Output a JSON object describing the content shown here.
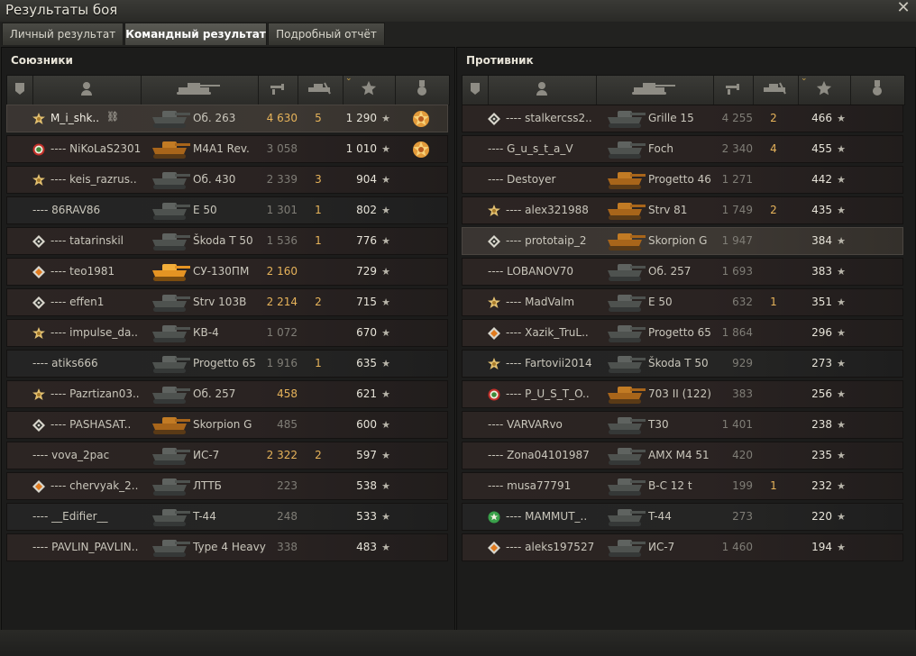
{
  "window": {
    "title": "Результаты боя"
  },
  "tabs": [
    {
      "label": "Личный результат",
      "active": false
    },
    {
      "label": "Командный результат",
      "active": true
    },
    {
      "label": "Подробный отчёт",
      "active": false
    }
  ],
  "columns": [
    "squad-icon",
    "player-icon",
    "tank-icon",
    "damage-icon",
    "kills-icon",
    "xp-star-icon",
    "medal-icon"
  ],
  "sort_column": "xp",
  "colors": {
    "accent": "#e6b35a",
    "dim_text": "#7f7d76",
    "text": "#c9c6bb",
    "highlight_row": "#3d3833"
  },
  "allies": {
    "title": "Союзники",
    "rows": [
      {
        "player": "M_i_shk..",
        "rank": "gold",
        "vehicle": "Об. 263",
        "tank_color": "gray",
        "damage": "4 630",
        "damage_hi": true,
        "kills": "5",
        "xp": "1 290",
        "star": "★",
        "medal": true,
        "squad": true,
        "highlight": true
      },
      {
        "player": "---- NiKoLaS2301",
        "rank": "red-green",
        "vehicle": "M4A1 Rev.",
        "tank_color": "orange",
        "damage": "3 058",
        "damage_hi": false,
        "kills": "",
        "xp": "1 010",
        "star": "★",
        "medal": true,
        "squad": false,
        "highlight": false
      },
      {
        "player": "---- keis_razrus..",
        "rank": "gold",
        "vehicle": "Об. 430",
        "tank_color": "gray",
        "damage": "2 339",
        "damage_hi": false,
        "kills": "3",
        "xp": "904",
        "star": "★",
        "medal": false,
        "squad": false,
        "highlight": false
      },
      {
        "player": "---- 86RAV86",
        "rank": "",
        "vehicle": "E 50",
        "tank_color": "gray",
        "damage": "1 301",
        "damage_hi": false,
        "kills": "1",
        "xp": "802",
        "star": "★",
        "medal": false,
        "squad": false,
        "highlight": false
      },
      {
        "player": "---- tatarinskil",
        "rank": "white",
        "vehicle": "Škoda T 50",
        "tank_color": "gray",
        "damage": "1 536",
        "damage_hi": false,
        "kills": "1",
        "xp": "776",
        "star": "★",
        "medal": false,
        "squad": false,
        "highlight": false
      },
      {
        "player": "---- teo1981",
        "rank": "orange",
        "vehicle": "СУ-130ПМ",
        "tank_color": "bright-orange",
        "damage": "2 160",
        "damage_hi": true,
        "kills": "",
        "xp": "729",
        "star": "★",
        "medal": false,
        "squad": false,
        "highlight": false
      },
      {
        "player": "---- effen1",
        "rank": "white",
        "vehicle": "Strv 103B",
        "tank_color": "gray",
        "damage": "2 214",
        "damage_hi": true,
        "kills": "2",
        "xp": "715",
        "star": "★",
        "medal": false,
        "squad": false,
        "highlight": false
      },
      {
        "player": "---- impulse_da..",
        "rank": "gold",
        "vehicle": "КВ-4",
        "tank_color": "gray",
        "damage": "1 072",
        "damage_hi": false,
        "kills": "",
        "xp": "670",
        "star": "★",
        "medal": false,
        "squad": false,
        "highlight": false
      },
      {
        "player": "---- atiks666",
        "rank": "",
        "vehicle": "Progetto 65",
        "tank_color": "gray",
        "damage": "1 916",
        "damage_hi": false,
        "kills": "1",
        "xp": "635",
        "star": "★",
        "medal": false,
        "squad": false,
        "highlight": false
      },
      {
        "player": "---- Pazrtizan03..",
        "rank": "gold",
        "vehicle": "Об. 257",
        "tank_color": "gray",
        "damage": "458",
        "damage_hi": true,
        "kills": "",
        "xp": "621",
        "star": "★",
        "medal": false,
        "squad": false,
        "highlight": false
      },
      {
        "player": "---- PASHASAT..",
        "rank": "white",
        "vehicle": "Skorpion G",
        "tank_color": "orange",
        "damage": "485",
        "damage_hi": false,
        "kills": "",
        "xp": "600",
        "star": "★",
        "medal": false,
        "squad": false,
        "highlight": false
      },
      {
        "player": "---- vova_2pac",
        "rank": "",
        "vehicle": "ИС-7",
        "tank_color": "gray",
        "damage": "2 322",
        "damage_hi": true,
        "kills": "2",
        "xp": "597",
        "star": "★",
        "medal": false,
        "squad": false,
        "highlight": false
      },
      {
        "player": "---- chervyak_2..",
        "rank": "orange",
        "vehicle": "ЛТТБ",
        "tank_color": "gray",
        "damage": "223",
        "damage_hi": false,
        "kills": "",
        "xp": "538",
        "star": "★",
        "medal": false,
        "squad": false,
        "highlight": false
      },
      {
        "player": "---- __Edifier__",
        "rank": "",
        "vehicle": "T-44",
        "tank_color": "gray",
        "damage": "248",
        "damage_hi": false,
        "kills": "",
        "xp": "533",
        "star": "★",
        "medal": false,
        "squad": false,
        "highlight": false
      },
      {
        "player": "---- PAVLIN_PAVLIN..",
        "rank": "",
        "vehicle": "Type 4 Heavy",
        "tank_color": "gray",
        "damage": "338",
        "damage_hi": false,
        "kills": "",
        "xp": "483",
        "star": "★",
        "medal": false,
        "squad": false,
        "highlight": false
      }
    ]
  },
  "enemies": {
    "title": "Противник",
    "rows": [
      {
        "player": "---- stalkercss2..",
        "rank": "white",
        "vehicle": "Grille 15",
        "tank_color": "gray",
        "damage": "4 255",
        "damage_hi": false,
        "kills": "2",
        "xp": "466",
        "star": "★",
        "medal": false,
        "highlight": false
      },
      {
        "player": "---- G_u_s_t_a_V",
        "rank": "",
        "vehicle": "Foch",
        "tank_color": "gray",
        "damage": "2 340",
        "damage_hi": false,
        "kills": "4",
        "xp": "455",
        "star": "★",
        "medal": false,
        "highlight": false
      },
      {
        "player": "---- Destoyer",
        "rank": "",
        "vehicle": "Progetto 46",
        "tank_color": "orange",
        "damage": "1 271",
        "damage_hi": false,
        "kills": "",
        "xp": "442",
        "star": "★",
        "medal": false,
        "highlight": false
      },
      {
        "player": "---- alex321988",
        "rank": "gold",
        "vehicle": "Strv 81",
        "tank_color": "orange",
        "damage": "1 749",
        "damage_hi": false,
        "kills": "2",
        "xp": "435",
        "star": "★",
        "medal": false,
        "highlight": false
      },
      {
        "player": "---- prototaip_2",
        "rank": "white",
        "vehicle": "Skorpion G",
        "tank_color": "orange",
        "damage": "1 947",
        "damage_hi": false,
        "kills": "",
        "xp": "384",
        "star": "★",
        "medal": false,
        "highlight": true
      },
      {
        "player": "---- LOBANOV70",
        "rank": "",
        "vehicle": "Об. 257",
        "tank_color": "gray",
        "damage": "1 693",
        "damage_hi": false,
        "kills": "",
        "xp": "383",
        "star": "★",
        "medal": false,
        "highlight": false
      },
      {
        "player": "---- MadValm",
        "rank": "gold",
        "vehicle": "E 50",
        "tank_color": "gray",
        "damage": "632",
        "damage_hi": false,
        "kills": "1",
        "xp": "351",
        "star": "★",
        "medal": false,
        "highlight": false
      },
      {
        "player": "---- Xazik_TruL..",
        "rank": "orange",
        "vehicle": "Progetto 65",
        "tank_color": "gray",
        "damage": "1 864",
        "damage_hi": false,
        "kills": "",
        "xp": "296",
        "star": "★",
        "medal": false,
        "highlight": false
      },
      {
        "player": "---- Fartovii2014",
        "rank": "gold",
        "vehicle": "Škoda T 50",
        "tank_color": "gray",
        "damage": "929",
        "damage_hi": false,
        "kills": "",
        "xp": "273",
        "star": "★",
        "medal": false,
        "highlight": false
      },
      {
        "player": "---- P_U_S_T_O..",
        "rank": "red-green",
        "vehicle": "703 II (122)",
        "tank_color": "orange",
        "damage": "383",
        "damage_hi": false,
        "kills": "",
        "xp": "256",
        "star": "★",
        "medal": false,
        "highlight": false
      },
      {
        "player": "---- VARVARvo",
        "rank": "",
        "vehicle": "T30",
        "tank_color": "gray",
        "damage": "1 401",
        "damage_hi": false,
        "kills": "",
        "xp": "238",
        "star": "★",
        "medal": false,
        "highlight": false
      },
      {
        "player": "---- Zona04101987",
        "rank": "",
        "vehicle": "AMX M4 51",
        "tank_color": "gray",
        "damage": "420",
        "damage_hi": false,
        "kills": "",
        "xp": "235",
        "star": "★",
        "medal": false,
        "highlight": false
      },
      {
        "player": "---- musa77791",
        "rank": "",
        "vehicle": "В-С 12 t",
        "tank_color": "gray",
        "damage": "199",
        "damage_hi": false,
        "kills": "1",
        "xp": "232",
        "star": "★",
        "medal": false,
        "highlight": false
      },
      {
        "player": "---- MAMMUT_..",
        "rank": "green",
        "vehicle": "T-44",
        "tank_color": "gray",
        "damage": "273",
        "damage_hi": false,
        "kills": "",
        "xp": "220",
        "star": "★",
        "medal": false,
        "highlight": false
      },
      {
        "player": "---- aleks197527",
        "rank": "orange",
        "vehicle": "ИС-7",
        "tank_color": "gray",
        "damage": "1 460",
        "damage_hi": false,
        "kills": "",
        "xp": "194",
        "star": "★",
        "medal": false,
        "highlight": false
      }
    ]
  }
}
